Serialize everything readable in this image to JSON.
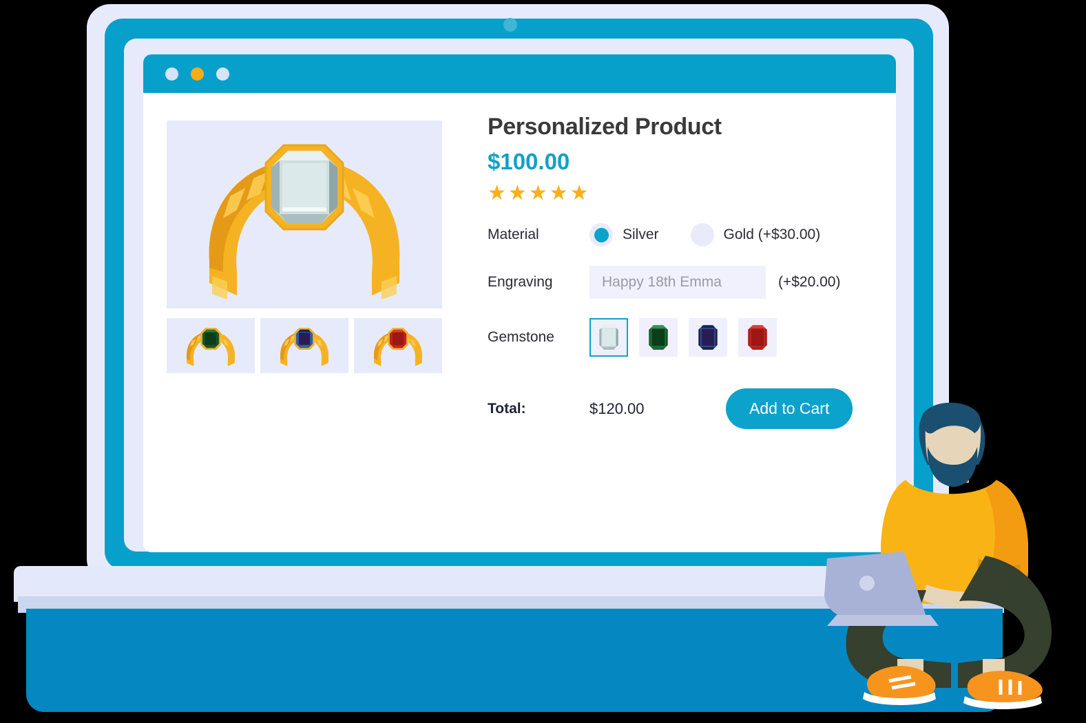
{
  "window": {
    "traffic_lights": [
      "minimize-dot",
      "maximize-dot",
      "close-dot"
    ]
  },
  "product": {
    "title": "Personalized Product",
    "price": "$100.00",
    "rating_stars": 5,
    "star_glyph": "★"
  },
  "options": {
    "material": {
      "label": "Material",
      "choices": [
        {
          "label": "Silver",
          "selected": true
        },
        {
          "label": "Gold (+$30.00)",
          "selected": false
        }
      ]
    },
    "engraving": {
      "label": "Engraving",
      "value": "",
      "placeholder": "Happy 18th Emma",
      "surcharge": "(+$20.00)"
    },
    "gemstone": {
      "label": "Gemstone",
      "choices": [
        {
          "name": "diamond",
          "selected": true
        },
        {
          "name": "emerald",
          "selected": false
        },
        {
          "name": "sapphire",
          "selected": false
        },
        {
          "name": "ruby",
          "selected": false
        }
      ]
    }
  },
  "summary": {
    "total_label": "Total:",
    "total_value": "$120.00",
    "add_to_cart_label": "Add to Cart"
  },
  "gallery": {
    "hero": "bracelet-diamond",
    "thumbnails": [
      "bracelet-emerald",
      "bracelet-sapphire",
      "bracelet-ruby"
    ]
  },
  "colors": {
    "accent_cyan": "#0BA2CC",
    "laptop_cyan": "#07A0CA",
    "base_blue": "#0587C2",
    "lavender": "#E7EAFB",
    "field_lavender": "#F0F1FC",
    "star_gold": "#FAAF17",
    "title_gray": "#3A3A3A",
    "gold_metal": "#F5B324",
    "gem_diamond": "#BCD2D6",
    "gem_emerald": "#16572A",
    "gem_sapphire": "#2B1B55",
    "gem_ruby": "#BE2420",
    "sweater_orange": "#F7A814",
    "pants_dark": "#35402F",
    "hair_navy": "#1A4F70",
    "skin": "#E6D5B8",
    "laptop_body": "#A8B1D6"
  }
}
